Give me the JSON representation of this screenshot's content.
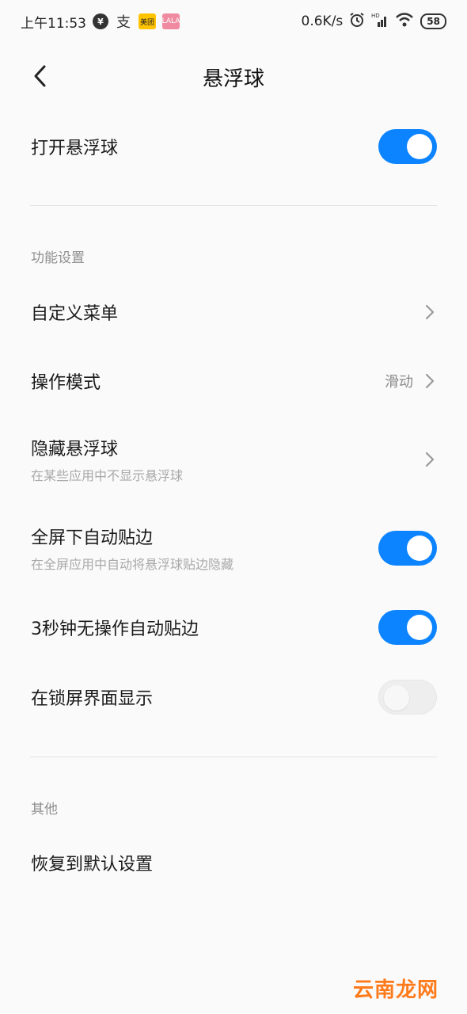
{
  "status_bar": {
    "time": "上午11:53",
    "icons": [
      "yuan-icon",
      "alipay-icon",
      "meituan-icon",
      "app-icon"
    ],
    "meituan_label": "美团",
    "pink_label": "LALA",
    "net_speed": "0.6K/s",
    "battery": "58"
  },
  "header": {
    "title": "悬浮球"
  },
  "main_toggle": {
    "label": "打开悬浮球",
    "on": true
  },
  "sections": [
    {
      "label": "功能设置",
      "items": [
        {
          "title": "自定义菜单",
          "type": "link"
        },
        {
          "title": "操作模式",
          "value": "滑动",
          "type": "link"
        },
        {
          "title": "隐藏悬浮球",
          "subtitle": "在某些应用中不显示悬浮球",
          "type": "link"
        },
        {
          "title": "全屏下自动贴边",
          "subtitle": "在全屏应用中自动将悬浮球贴边隐藏",
          "type": "toggle",
          "on": true
        },
        {
          "title": "3秒钟无操作自动贴边",
          "type": "toggle",
          "on": true
        },
        {
          "title": "在锁屏界面显示",
          "type": "toggle",
          "on": false
        }
      ]
    },
    {
      "label": "其他",
      "items": [
        {
          "title": "恢复到默认设置",
          "type": "link"
        }
      ]
    }
  ],
  "watermark": "云南龙网",
  "colors": {
    "accent": "#0d84ff",
    "background": "#fafafa",
    "watermark": "#ff7a1a"
  }
}
